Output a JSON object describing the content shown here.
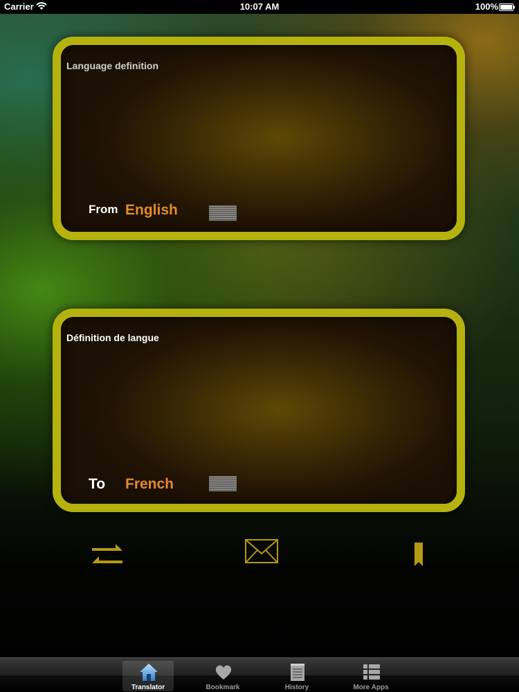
{
  "status_bar": {
    "carrier": "Carrier",
    "time": "10:07 AM",
    "battery": "100%"
  },
  "source_panel": {
    "text": "Language definition",
    "label": "From",
    "language": "English"
  },
  "target_panel": {
    "text": "Définition de langue",
    "label": "To",
    "language": "French"
  },
  "actions": {
    "swap_icon": "swap-arrows-icon",
    "mail_icon": "envelope-icon",
    "bookmark_icon": "bookmark-icon"
  },
  "tabs": [
    {
      "label": "Translator",
      "icon": "home-icon",
      "active": true
    },
    {
      "label": "Bookmark",
      "icon": "heart-icon",
      "active": false
    },
    {
      "label": "History",
      "icon": "notepad-icon",
      "active": false
    },
    {
      "label": "More Apps",
      "icon": "list-icon",
      "active": false
    }
  ],
  "colors": {
    "panel_border": "#b5b20f",
    "language_value": "#e48a2c",
    "icon_gold": "#b59a14"
  }
}
